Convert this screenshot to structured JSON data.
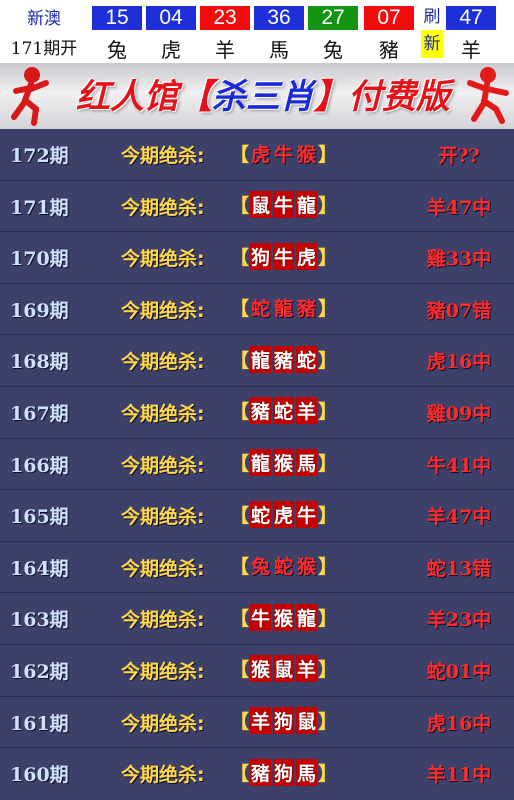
{
  "header": {
    "region": "新澳",
    "period_label": "171期开",
    "balls": [
      {
        "number": "15",
        "zodiac": "兔",
        "color": "blue"
      },
      {
        "number": "04",
        "zodiac": "虎",
        "color": "blue"
      },
      {
        "number": "23",
        "zodiac": "羊",
        "color": "red"
      },
      {
        "number": "36",
        "zodiac": "馬",
        "color": "blue"
      },
      {
        "number": "27",
        "zodiac": "兔",
        "color": "green"
      },
      {
        "number": "07",
        "zodiac": "豬",
        "color": "red"
      },
      {
        "number": "47",
        "zodiac": "羊",
        "color": "blue"
      }
    ],
    "refresh_top": "刷",
    "refresh_bottom": "新"
  },
  "banner": {
    "title_left": "红人馆【",
    "title_mid": "杀三肖",
    "title_right": "】付费版"
  },
  "colors": {
    "ball_blue": "#1d2fd9",
    "ball_red": "#f20c0c",
    "ball_green": "#139413",
    "list_background": "#3d4169",
    "label_yellow": "#ffd84a",
    "result_red": "#ff2b2b"
  },
  "rows": [
    {
      "issue": "172期",
      "label": "今期绝杀:",
      "open": "【",
      "close": "】",
      "picks": [
        "虎",
        "牛",
        "猴"
      ],
      "hit": [
        false,
        false,
        false
      ],
      "result": "开??"
    },
    {
      "issue": "171期",
      "label": "今期绝杀:",
      "open": "【",
      "close": "】",
      "picks": [
        "鼠",
        "牛",
        "龍"
      ],
      "hit": [
        true,
        true,
        true
      ],
      "result": "羊47中"
    },
    {
      "issue": "170期",
      "label": "今期绝杀:",
      "open": "【",
      "close": "】",
      "picks": [
        "狗",
        "牛",
        "虎"
      ],
      "hit": [
        true,
        true,
        true
      ],
      "result": "雞33中"
    },
    {
      "issue": "169期",
      "label": "今期绝杀:",
      "open": "【",
      "close": "】",
      "picks": [
        "蛇",
        "龍",
        "豬"
      ],
      "hit": [
        false,
        false,
        false
      ],
      "result": "豬07错"
    },
    {
      "issue": "168期",
      "label": "今期绝杀:",
      "open": "【",
      "close": "】",
      "picks": [
        "龍",
        "豬",
        "蛇"
      ],
      "hit": [
        true,
        true,
        true
      ],
      "result": "虎16中"
    },
    {
      "issue": "167期",
      "label": "今期绝杀:",
      "open": "【",
      "close": "】",
      "picks": [
        "豬",
        "蛇",
        "羊"
      ],
      "hit": [
        true,
        true,
        true
      ],
      "result": "雞09中"
    },
    {
      "issue": "166期",
      "label": "今期绝杀:",
      "open": "【",
      "close": "】",
      "picks": [
        "龍",
        "猴",
        "馬"
      ],
      "hit": [
        true,
        true,
        true
      ],
      "result": "牛41中"
    },
    {
      "issue": "165期",
      "label": "今期绝杀:",
      "open": "【",
      "close": "】",
      "picks": [
        "蛇",
        "虎",
        "牛"
      ],
      "hit": [
        true,
        true,
        true
      ],
      "result": "羊47中"
    },
    {
      "issue": "164期",
      "label": "今期绝杀:",
      "open": "【",
      "close": "】",
      "picks": [
        "兔",
        "蛇",
        "猴"
      ],
      "hit": [
        false,
        false,
        false
      ],
      "result": "蛇13错"
    },
    {
      "issue": "163期",
      "label": "今期绝杀:",
      "open": "【",
      "close": "】",
      "picks": [
        "牛",
        "猴",
        "龍"
      ],
      "hit": [
        true,
        true,
        true
      ],
      "result": "羊23中"
    },
    {
      "issue": "162期",
      "label": "今期绝杀:",
      "open": "【",
      "close": "】",
      "picks": [
        "猴",
        "鼠",
        "羊"
      ],
      "hit": [
        true,
        true,
        true
      ],
      "result": "蛇01中"
    },
    {
      "issue": "161期",
      "label": "今期绝杀:",
      "open": "【",
      "close": "】",
      "picks": [
        "羊",
        "狗",
        "鼠"
      ],
      "hit": [
        true,
        true,
        true
      ],
      "result": "虎16中"
    },
    {
      "issue": "160期",
      "label": "今期绝杀:",
      "open": "【",
      "close": "】",
      "picks": [
        "豬",
        "狗",
        "馬"
      ],
      "hit": [
        true,
        true,
        true
      ],
      "result": "羊11中"
    }
  ]
}
